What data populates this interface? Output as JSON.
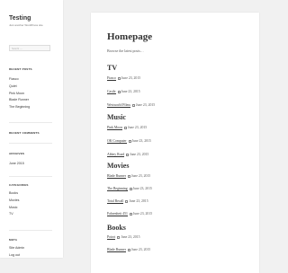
{
  "site": {
    "title": "Testing",
    "description": "Just another WordPress site"
  },
  "search": {
    "placeholder": "Search …"
  },
  "widgets": {
    "recent_posts": {
      "title": "RECENT POSTS",
      "items": [
        "Fiasco",
        "Quiet",
        "Pink Moon",
        "Blade Runner",
        "The Beginning"
      ]
    },
    "recent_comments": {
      "title": "RECENT COMMENTS"
    },
    "archives": {
      "title": "ARCHIVES",
      "items": [
        "June 2015"
      ]
    },
    "categories": {
      "title": "CATEGORIES",
      "items": [
        "Books",
        "Movies",
        "Music",
        "TV"
      ]
    },
    "meta": {
      "title": "META",
      "items": [
        "Site Admin",
        "Log out"
      ]
    }
  },
  "main": {
    "title": "Homepage",
    "intro": "Browse the latest posts…",
    "sections": [
      {
        "heading": "TV",
        "entries": [
          {
            "title": "Fiasco",
            "date": "June 23, 2015"
          },
          {
            "title": "Castle",
            "date": "June 23, 2015"
          },
          {
            "title": "Westworld Films",
            "date": "June 23, 2015"
          }
        ]
      },
      {
        "heading": "Music",
        "entries": [
          {
            "title": "Pink Moon",
            "date": "June 23, 2015"
          },
          {
            "title": "OK Computer",
            "date": "June 23, 2015"
          },
          {
            "title": "Abbey Road",
            "date": "June 23, 2015"
          }
        ]
      },
      {
        "heading": "Movies",
        "entries": [
          {
            "title": "Blade Runner",
            "date": "June 23, 2015"
          },
          {
            "title": "The Beginning",
            "date": "June 23, 2015"
          },
          {
            "title": "Total Recall",
            "date": "June 23, 2015"
          },
          {
            "title": "Fahrenheit 451",
            "date": "June 23, 2015"
          }
        ]
      },
      {
        "heading": "Books",
        "entries": [
          {
            "title": "Poirot",
            "date": "June 23, 2015"
          },
          {
            "title": "Blade Runner",
            "date": "June 23, 2015"
          }
        ]
      }
    ]
  },
  "colors": {
    "background": "#f1f1f1",
    "panel": "#ffffff",
    "text": "#333333"
  }
}
